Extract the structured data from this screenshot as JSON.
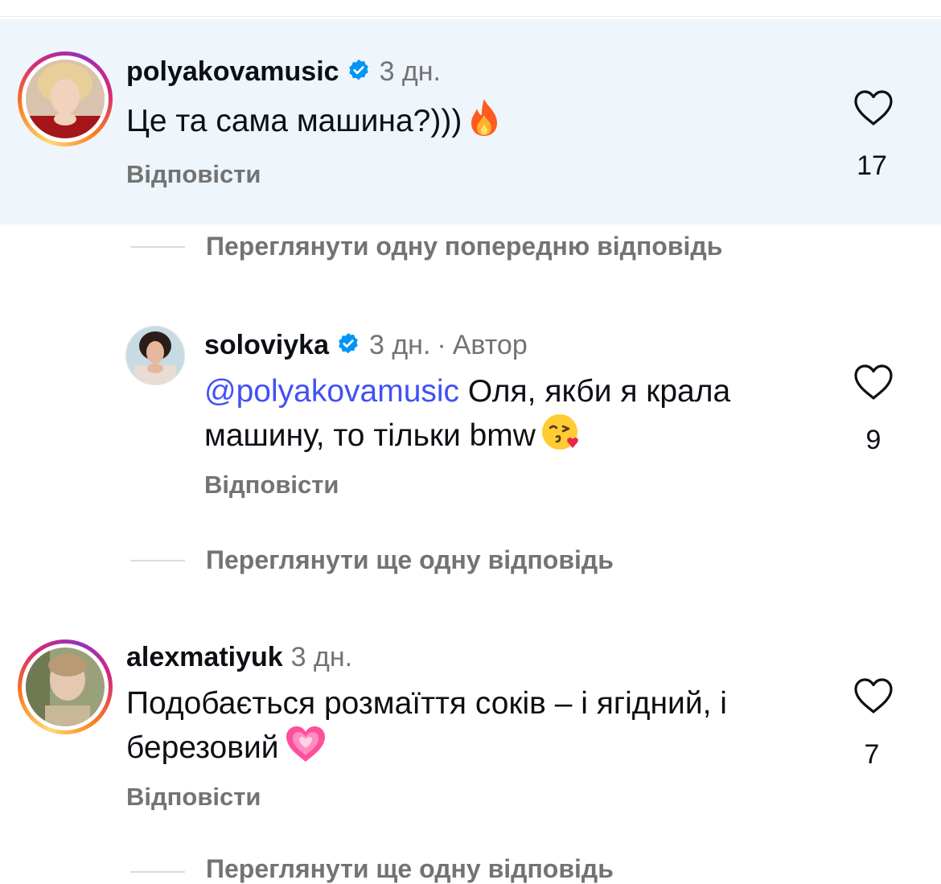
{
  "comments": [
    {
      "username": "polyakovamusic",
      "verified": true,
      "time": "3 дн.",
      "text": "Це та сама машина?)))",
      "emoji": "fire-emoji",
      "reply_label": "Відповісти",
      "likes": "17",
      "highlighted": true
    },
    {
      "username": "soloviyka",
      "verified": true,
      "time": "3 дн.",
      "author_label": "Автор",
      "mention": "@polyakovamusic",
      "text_line1": " Оля, якби я крала",
      "text_line2": "машину, то тільки bmw",
      "emoji": "kissing-face-heart-emoji",
      "reply_label": "Відповісти",
      "likes": "9"
    },
    {
      "username": "alexmatiyuk",
      "verified": false,
      "time": "3 дн.",
      "text_line1": "Подобається розмаїття соків – і ягідний, і",
      "text_line2": "березовий",
      "emoji": "pink-heart-emoji",
      "reply_label": "Відповісти",
      "likes": "7"
    }
  ],
  "threads": [
    {
      "label": "Переглянути одну попередню відповідь"
    },
    {
      "label": "Переглянути ще одну відповідь"
    },
    {
      "label": "Переглянути ще одну відповідь"
    }
  ],
  "colors": {
    "highlight_bg": "#eef5fb",
    "mention": "#4150f7",
    "muted": "#737373",
    "verified": "#0095f6"
  }
}
